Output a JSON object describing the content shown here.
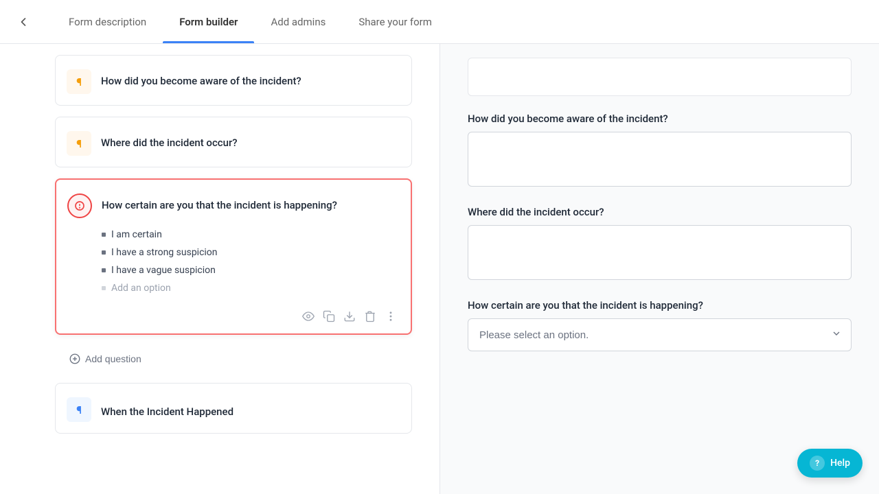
{
  "nav": {
    "back_label": "",
    "tabs": [
      {
        "id": "form-description",
        "label": "Form description",
        "active": false
      },
      {
        "id": "form-builder",
        "label": "Form builder",
        "active": true
      },
      {
        "id": "add-admins",
        "label": "Add admins",
        "active": false
      },
      {
        "id": "share-your-form",
        "label": "Share your form",
        "active": false
      }
    ]
  },
  "left_panel": {
    "questions": [
      {
        "id": "q1",
        "icon_type": "orange",
        "icon_text": "¶",
        "text": "How did you become aware of the incident?",
        "active": false,
        "has_options": false
      },
      {
        "id": "q2",
        "icon_type": "orange",
        "icon_text": "¶",
        "text": "Where did the incident occur?",
        "active": false,
        "has_options": false
      },
      {
        "id": "q3",
        "icon_type": "red",
        "icon_text": "○",
        "text": "How certain are you that the incident is happening?",
        "active": true,
        "has_options": true,
        "options": [
          "I am certain",
          "I have a strong suspicion",
          "I have a vague suspicion"
        ],
        "add_option_label": "Add an option"
      }
    ],
    "add_question_label": "Add question",
    "when_card": {
      "icon_text": "¶",
      "text": "When the Incident Happened"
    }
  },
  "right_panel": {
    "questions": [
      {
        "id": "rq1",
        "label": "How did you become aware of the incident?",
        "type": "textarea"
      },
      {
        "id": "rq2",
        "label": "Where did the incident occur?",
        "type": "textarea"
      },
      {
        "id": "rq3",
        "label": "How certain are you that the incident is happening?",
        "type": "select",
        "placeholder": "Please select an option."
      }
    ]
  },
  "help_button": {
    "label": "Help"
  },
  "icons": {
    "back": "←",
    "eye": "👁",
    "copy": "⧉",
    "download": "⬇",
    "delete": "🗑",
    "more": "⋮",
    "add_circle": "⊕",
    "chevron_down": "▾"
  }
}
